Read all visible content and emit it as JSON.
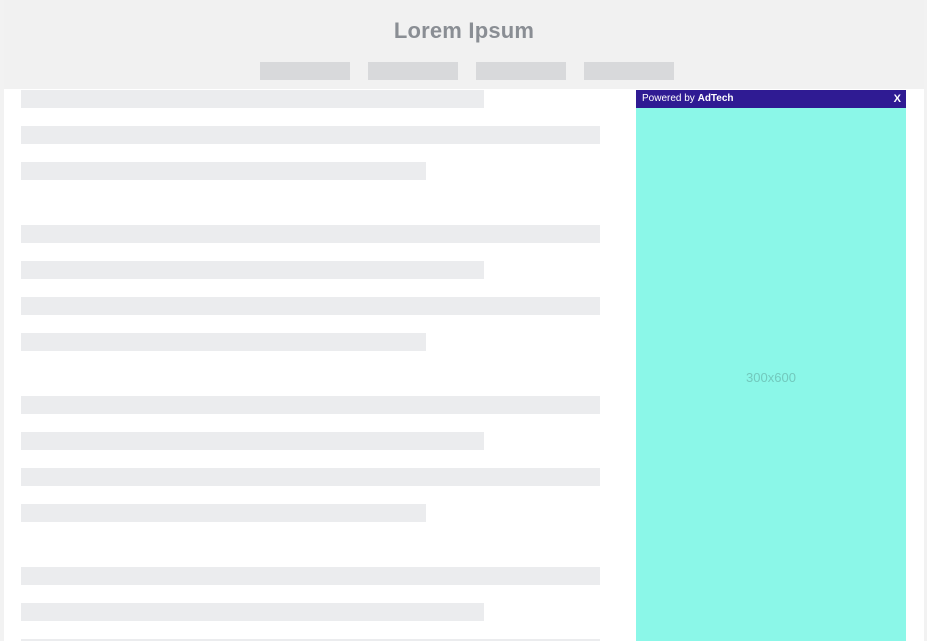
{
  "header": {
    "title": "Lorem Ipsum",
    "nav_items": [
      {
        "label": ""
      },
      {
        "label": ""
      },
      {
        "label": ""
      },
      {
        "label": ""
      }
    ]
  },
  "ad": {
    "powered_prefix": "Powered by",
    "brand": "AdTech",
    "close_label": "X",
    "size_label": "300x600",
    "bar_color": "#2f1b93",
    "background_color": "#8bf7e8"
  },
  "colors": {
    "header_bg": "#f1f1f1",
    "title_color": "#8a8e94",
    "nav_placeholder": "#d8d9db",
    "text_placeholder": "#ebecee"
  }
}
